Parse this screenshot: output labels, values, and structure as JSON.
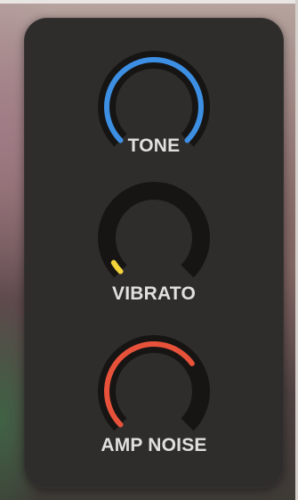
{
  "knobs": [
    {
      "label": "TONE",
      "value": 1.0,
      "color": "#3d8fe3"
    },
    {
      "label": "VIBRATO",
      "value": 0.05,
      "color": "#f2d33a"
    },
    {
      "label": "AMP NOISE",
      "value": 0.7,
      "color": "#e8523a"
    }
  ],
  "colors": {
    "panel": "#2f2d2c",
    "track": "#161514",
    "label": "#e1e0dd"
  }
}
